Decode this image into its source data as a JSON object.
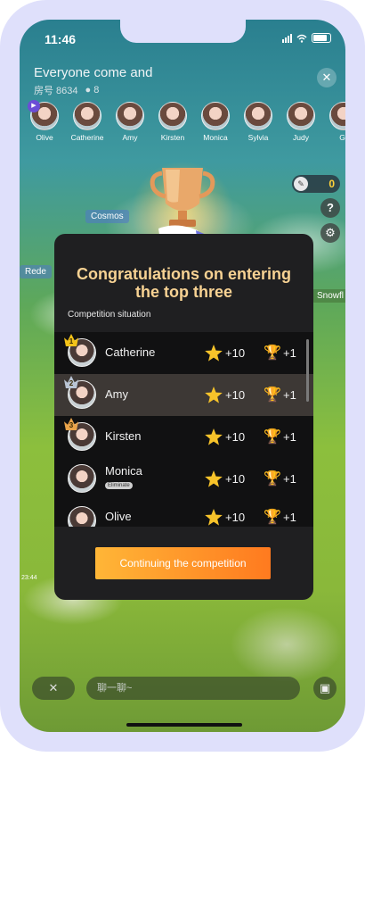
{
  "status": {
    "time": "11:46"
  },
  "room": {
    "title": "Everyone come and",
    "id_label": "房号 8634",
    "members": "8"
  },
  "players": [
    {
      "name": "Olive"
    },
    {
      "name": "Catherine"
    },
    {
      "name": "Amy"
    },
    {
      "name": "Kirsten"
    },
    {
      "name": "Monica"
    },
    {
      "name": "Sylvia"
    },
    {
      "name": "Judy"
    },
    {
      "name": "Gr"
    }
  ],
  "side": {
    "pen_count": "0",
    "help_icon": "?"
  },
  "background_labels": {
    "cosmo": "Cosmos",
    "rede": "Rede",
    "snowfl": "Snowfl",
    "ts": "23:44"
  },
  "modal": {
    "title_line1": "Congratulations on entering",
    "title_line2": "the top three",
    "section_label": "Competition situation",
    "rows": [
      {
        "rank": "1",
        "name": "Catherine",
        "stars": "+10",
        "trophies": "+1",
        "tag": ""
      },
      {
        "rank": "2",
        "name": "Amy",
        "stars": "+10",
        "trophies": "+1",
        "tag": ""
      },
      {
        "rank": "3",
        "name": "Kirsten",
        "stars": "+10",
        "trophies": "+1",
        "tag": ""
      },
      {
        "rank": "",
        "name": "Monica",
        "stars": "+10",
        "trophies": "+1",
        "tag": "Eliminate"
      },
      {
        "rank": "",
        "name": "Olive",
        "stars": "+10",
        "trophies": "+1",
        "tag": ""
      }
    ],
    "cta": "Continuing the competition"
  },
  "bottom": {
    "chat_placeholder": "聊一聊~"
  },
  "colors": {
    "accent_gold": "#f7d293",
    "cta_start": "#ffb637",
    "cta_end": "#ff7a1f",
    "frame": "#dfe0fb"
  }
}
